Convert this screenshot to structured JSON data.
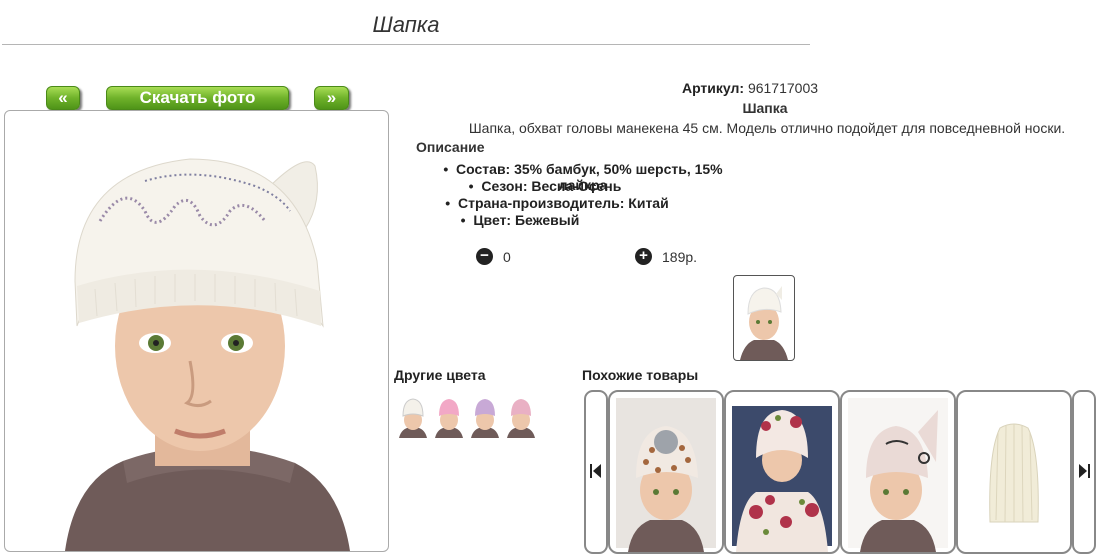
{
  "page": {
    "title": "Шапка"
  },
  "gallery": {
    "prev_label": "«",
    "download_label": "Скачать фото",
    "next_label": "»"
  },
  "product": {
    "article_label": "Артикул:",
    "article_value": "961717003",
    "name": "Шапка",
    "description": "Шапка, обхват головы манекена 45 см. Модель отлично подойдет для повседневной носки.",
    "description_heading": "Описание",
    "specs": [
      "Состав: 35% бамбук, 50% шерсть, 15% лайкра",
      "Сезон: Весна-Осень",
      "Страна-производитель: Китай",
      "Цвет: Бежевый"
    ]
  },
  "cart": {
    "minus_symbol": "−",
    "quantity": "0",
    "plus_symbol": "+",
    "price": "189р."
  },
  "other_colors": {
    "heading": "Другие цвета",
    "swatches": [
      "#f4f1ea",
      "#f2a8c6",
      "#c8a9d6",
      "#e9b0c4"
    ]
  },
  "similar": {
    "heading": "Похожие товары",
    "prev_icon": "arrow-left-icon",
    "next_icon": "arrow-right-icon"
  },
  "colors": {
    "button_green": "#6fb22a",
    "hat_beige": "#f4f1ea",
    "sweater": "#6e5a58"
  }
}
